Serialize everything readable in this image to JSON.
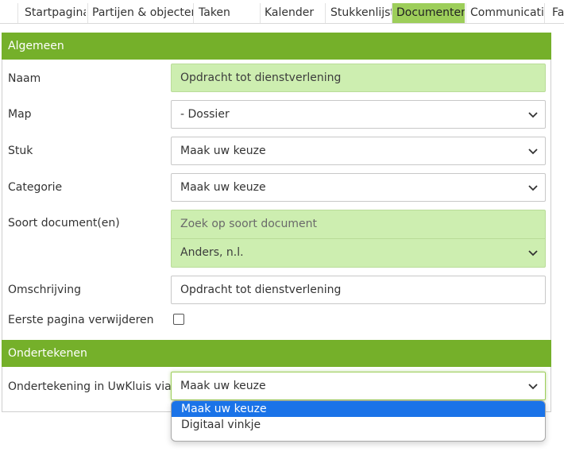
{
  "tabs": [
    {
      "label": "Startpagina",
      "active": false
    },
    {
      "label": "Partijen & objecten",
      "active": false
    },
    {
      "label": "Taken",
      "active": false
    },
    {
      "label": "Kalender",
      "active": false
    },
    {
      "label": "Stukkenlijst",
      "active": false
    },
    {
      "label": "Documenten",
      "active": true
    },
    {
      "label": "Communicatie",
      "active": false
    },
    {
      "label": "Fa",
      "active": false
    }
  ],
  "sections": {
    "general": {
      "title": "Algemeen"
    },
    "signing": {
      "title": "Ondertekenen"
    }
  },
  "fields": {
    "naam": {
      "label": "Naam",
      "value": "Opdracht tot dienstverlening"
    },
    "map": {
      "label": "Map",
      "value": "- Dossier"
    },
    "stuk": {
      "label": "Stuk",
      "value": "Maak uw keuze"
    },
    "categorie": {
      "label": "Categorie",
      "value": "Maak uw keuze"
    },
    "soort": {
      "label": "Soort document(en)",
      "placeholder": "Zoek op soort document",
      "value": "Anders, n.l."
    },
    "omschrijving": {
      "label": "Omschrijving",
      "value": "Opdracht tot dienstverlening"
    },
    "eerste_pagina": {
      "label": "Eerste pagina verwijderen",
      "checked": false
    },
    "ondertekening": {
      "label": "Ondertekening in UwKluis via",
      "value": "Maak uw keuze",
      "options": [
        "Maak uw keuze",
        "Digitaal vinkje"
      ],
      "highlighted": "Maak uw keuze"
    }
  },
  "colors": {
    "section_header": "#75b02a",
    "active_tab": "#9dce5a",
    "green_field": "#cdeeb0",
    "option_highlight": "#1a73e8"
  },
  "icons": {
    "select_arrow": "chevron-down-icon"
  }
}
